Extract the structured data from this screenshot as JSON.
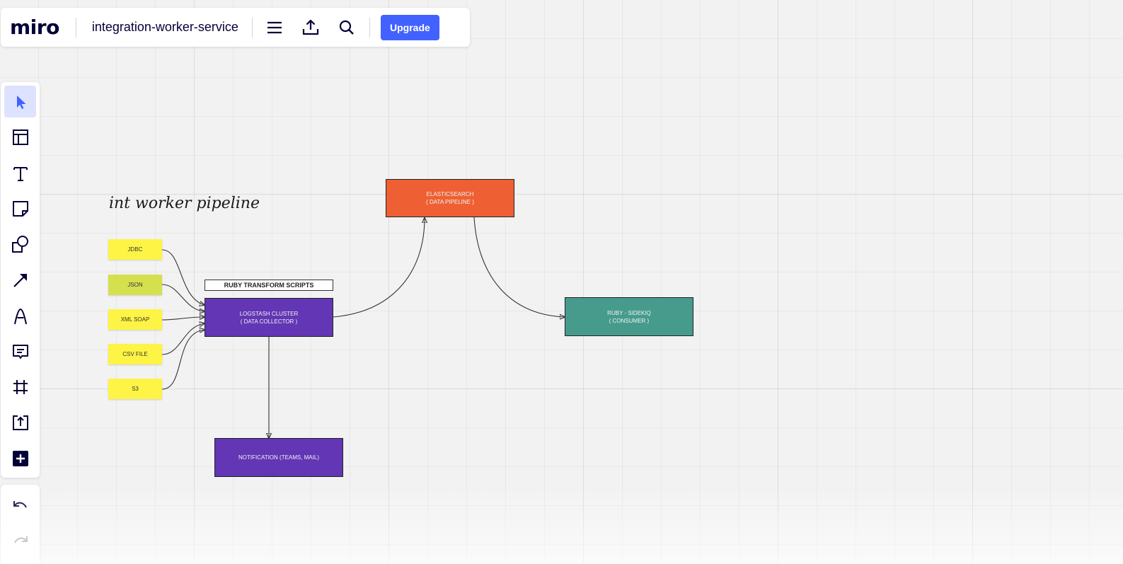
{
  "app": {
    "logo": "miro",
    "board_title": "integration-worker-service",
    "upgrade_label": "Upgrade"
  },
  "topbar": {
    "icons": [
      "menu-icon",
      "export-icon",
      "search-icon"
    ]
  },
  "toolbar": {
    "tools": [
      "select-tool",
      "templates-tool",
      "text-tool",
      "sticky-note-tool",
      "shapes-tool",
      "connection-line-tool",
      "pen-tool",
      "comment-tool",
      "frame-tool",
      "upload-tool",
      "more-apps-tool"
    ],
    "active": "select-tool"
  },
  "undo": {
    "icons": [
      "undo-icon",
      "redo-icon"
    ]
  },
  "canvas": {
    "heading": "int worker pipeline",
    "stickies": [
      {
        "text": "JDBC",
        "color": "#fef445"
      },
      {
        "text": "JSON",
        "color": "#d5e04f"
      },
      {
        "text": "XML SOAP",
        "color": "#fef445"
      },
      {
        "text": "CSV FILE",
        "color": "#fef445"
      },
      {
        "text": "S3",
        "color": "#fef445"
      }
    ],
    "ruby_label": "RUBY TRANSFORM SCRIPTS",
    "logstash": {
      "line1": "LOGSTASH CLUSTER",
      "line2": "(  DATA COLLECTOR )",
      "color": "#6236b4"
    },
    "elasticsearch": {
      "line1": "ELASTICSEARCH",
      "line2": "( DATA PIPELINE )",
      "color": "#ee6033"
    },
    "sidekiq": {
      "line1": "RUBY - SIDEKIQ",
      "line2": "( CONSUMER )",
      "color": "#469b8c"
    },
    "notification": {
      "line1": "NOTIFICATION (TEAMS, MAIL)",
      "color": "#6236b4"
    }
  }
}
